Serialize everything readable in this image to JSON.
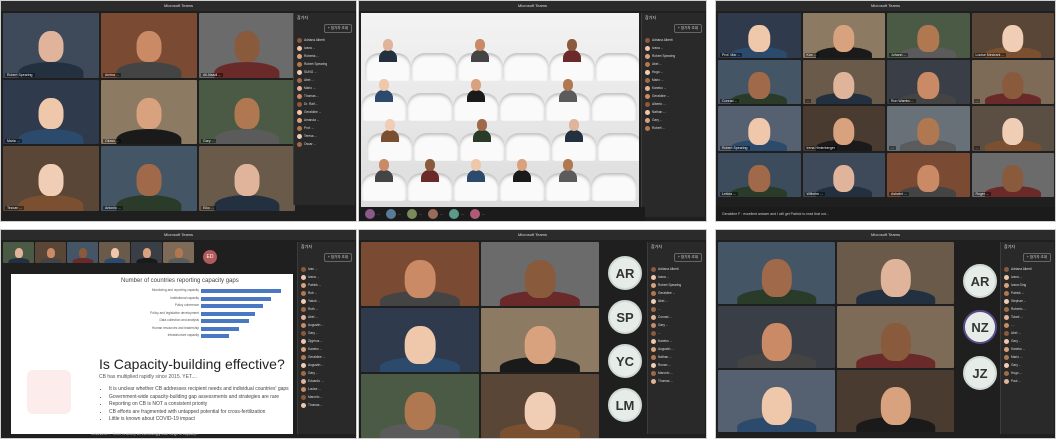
{
  "window_title": "Microsoft Teams",
  "panels": {
    "participants_title": "참가자",
    "invite_label": "+ 참가자 초대"
  },
  "shot1": {
    "tiles": [
      {
        "name": "Robert Spearing"
      },
      {
        "name": "Amina ..."
      },
      {
        "name": "Ali Alsadi ..."
      },
      {
        "name": "Maria ..."
      },
      {
        "name": "Oluwo ..."
      },
      {
        "name": "Gary ..."
      },
      {
        "name": "Tezcan ..."
      },
      {
        "name": "Antonio ..."
      },
      {
        "name": "Eiko ..."
      }
    ],
    "participants": [
      "Adriana Alberti",
      "Ivana ...",
      "Roberta ...",
      "Robert Spearing",
      "SUNG ...",
      "Abel ...",
      "Mario ...",
      "Thomas ...",
      "Dr. Ralf ...",
      "Geraldine ...",
      "Amanda ...",
      "Prof. ...",
      "Teresa ...",
      "Oscar ..."
    ]
  },
  "shot2": {
    "participants": [
      "Adriana Alberti",
      "Ivana ...",
      "Robert Spearing",
      "Abel ...",
      "Hugo ...",
      "Mario ...",
      "Kaneko ...",
      "Geraldine ...",
      "Alberto ...",
      "Nathan ...",
      "Gary ...",
      "Robert ..."
    ],
    "bottom_names": [
      "...",
      "...",
      "...",
      "...",
      "...",
      "..."
    ]
  },
  "shot3": {
    "tiles": [
      {
        "name": "Prof. Mar ..."
      },
      {
        "name": "Kan ..."
      },
      {
        "name": "Johann ..."
      },
      {
        "name": "Louise Mindrant ..."
      },
      {
        "name": "Conrad ..."
      },
      {
        "name": "..."
      },
      {
        "name": "Ron Wambu ..."
      },
      {
        "name": "..."
      },
      {
        "name": "Robert Spearing"
      },
      {
        "name": "Irena Hinterberger"
      },
      {
        "name": "..."
      },
      {
        "name": "..."
      },
      {
        "name": "Leticia ..."
      },
      {
        "name": "Wilhelm ..."
      },
      {
        "name": "Ashwini ..."
      },
      {
        "name": "Roger ..."
      }
    ],
    "chat": "Geraldine F : excellent answer and I will get Patrick to read that out..."
  },
  "shot4": {
    "slide": {
      "chart_title": "Number of countries reporting capacity gaps",
      "bars": [
        {
          "label": "Monitoring and reporting capacity",
          "value": 40
        },
        {
          "label": "Institutional capacity",
          "value": 35
        },
        {
          "label": "Policy coherence",
          "value": 31
        },
        {
          "label": "Policy and legislative development",
          "value": 27
        },
        {
          "label": "Data collection and analysis",
          "value": 24
        },
        {
          "label": "Human resources and leadership",
          "value": 19
        },
        {
          "label": "Infrastructure capacity",
          "value": 14
        }
      ],
      "headline": "Is Capacity-building effective?",
      "subline": "CB has multiplied rapidly since 2015. YET....",
      "bullets": [
        "It is unclear whether CB addresses recipient needs and individual countries' gaps",
        "Government-wide capacity-building gap assessments and strategies are rare",
        "Reporting on CB is NOT a consistent priority",
        "CB efforts are fragmented with untapped potential for cross-fertilization",
        "Little is known about COVID-19 impact"
      ]
    },
    "initials": "ED",
    "participants": [
      "Ivan ...",
      "Ivana ...",
      "Patrick ...",
      "Rob ...",
      "Yakub ...",
      "Ruth ...",
      "Abel ...",
      "Augustin ...",
      "Gary ...",
      "Zipphus ...",
      "Kaneko ...",
      "Geraldine ...",
      "Augustin ...",
      "Gary ...",
      "Eduardo ...",
      "Louise ...",
      "Marcelo ...",
      "Thomas ..."
    ],
    "caption": "Johandros ... There is clearly an increasingly wide range of capacity..."
  },
  "shot5": {
    "monograms": [
      "AR",
      "SP",
      "YC",
      "LM"
    ],
    "participants": [
      "Adriana Alberti",
      "Ivana ...",
      "Robert Spearing",
      "Geraldine ...",
      "Abel ...",
      "...",
      "Conrad ...",
      "Gary ...",
      "...",
      "Kaneko ...",
      "Augustin ...",
      "Nathan ...",
      "Ronan ...",
      "Marcelo ...",
      "Thomas ..."
    ]
  },
  "shot6": {
    "monograms": [
      "AR",
      "NZ",
      "JZ"
    ],
    "participants": [
      "Adriana Alberti",
      "Ivana ...",
      "Ivana Ding",
      "Patrick ...",
      "Stephan ...",
      "Roberto ...",
      "Tolani ...",
      "...",
      "Abel ...",
      "Gary ...",
      "Kaneko ...",
      "Mario ...",
      "Gary ...",
      "Hugo ...",
      "Paul ..."
    ]
  },
  "colors": {
    "teams_red": "#c4314b",
    "dark_bg": "#1f1f1f",
    "panel_bg": "#292929"
  }
}
